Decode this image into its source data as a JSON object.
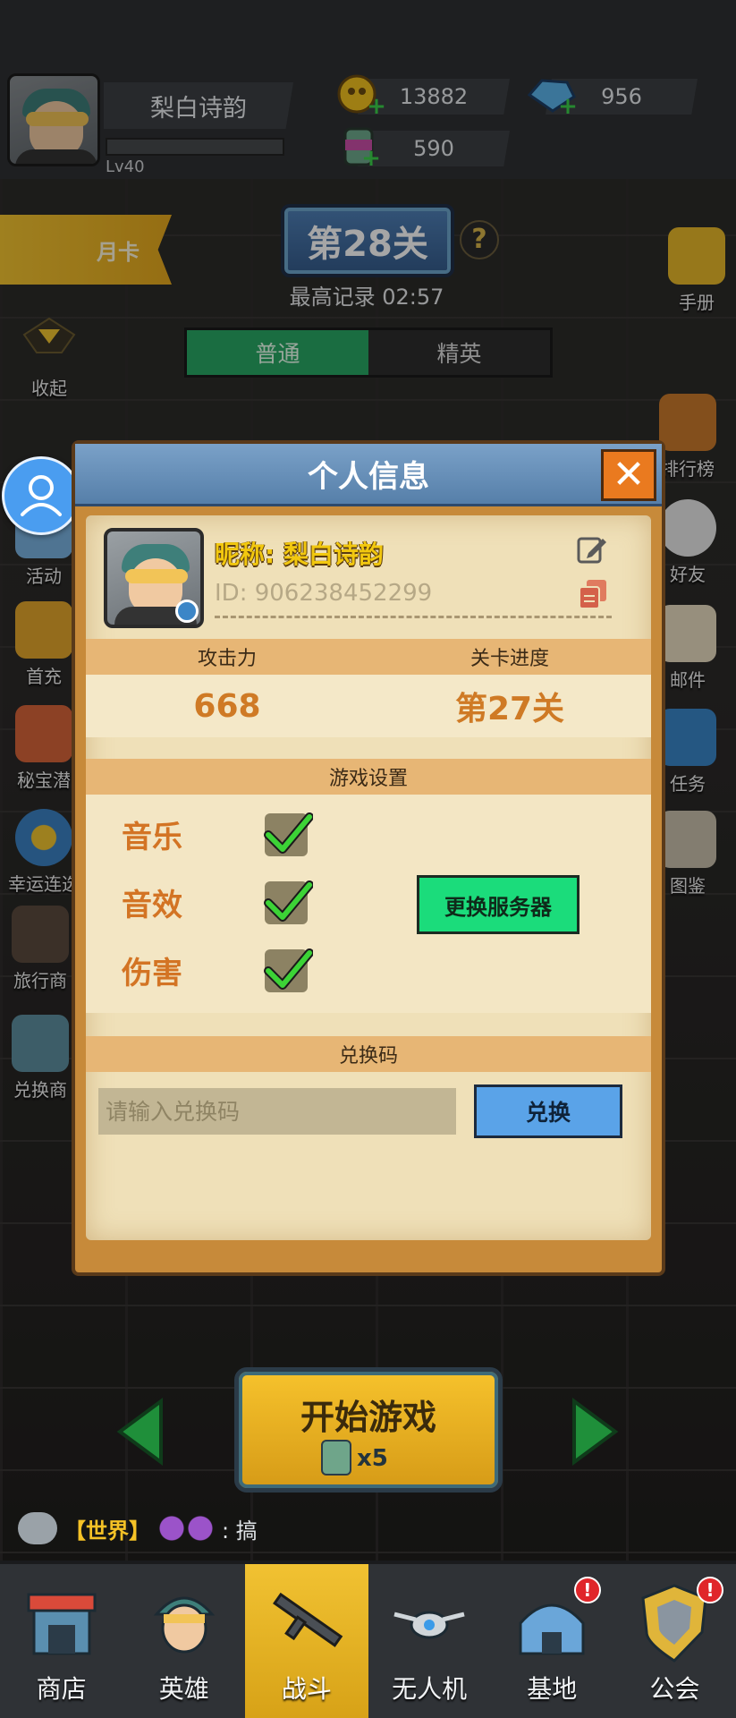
{
  "player": {
    "name": "梨白诗韵",
    "level": "Lv40"
  },
  "resources": {
    "gold": "13882",
    "gems": "956",
    "energy": "590"
  },
  "stage": {
    "month_card": "月卡",
    "current_stage": "第28关",
    "best_record": "最高记录 02:57",
    "modes": [
      "普通",
      "精英"
    ],
    "active_mode": "普通"
  },
  "left_menu": [
    {
      "label": "收起",
      "icon": "collapse-arrow-icon"
    },
    {
      "label": "活动",
      "icon": "gift-icon"
    },
    {
      "label": "首充",
      "icon": "treasure-chest-icon"
    },
    {
      "label": "秘宝潜",
      "icon": "mystery-box-icon"
    },
    {
      "label": "幸运连选",
      "icon": "lucky-wheel-icon"
    },
    {
      "label": "旅行商",
      "icon": "merchant-icon"
    },
    {
      "label": "兑换商",
      "icon": "vending-machine-icon"
    }
  ],
  "right_menu": [
    {
      "label": "手册",
      "icon": "handbook-icon"
    },
    {
      "label": "排行榜",
      "icon": "leaderboard-icon"
    },
    {
      "label": "好友",
      "icon": "friends-icon"
    },
    {
      "label": "邮件",
      "icon": "mail-icon"
    },
    {
      "label": "任务",
      "icon": "calendar-icon"
    },
    {
      "label": "图鉴",
      "icon": "album-icon"
    }
  ],
  "modal": {
    "title": "个人信息",
    "nickname": "昵称: 梨白诗韵",
    "player_id": "ID: 906238452299",
    "attack_label": "攻击力",
    "attack_value": "668",
    "progress_label": "关卡进度",
    "progress_value": "第27关",
    "settings_title": "游戏设置",
    "settings": [
      {
        "label": "音乐",
        "checked": true
      },
      {
        "label": "音效",
        "checked": true
      },
      {
        "label": "伤害",
        "checked": true
      }
    ],
    "server_button": "更换服务器",
    "redeem_title": "兑换码",
    "redeem_placeholder": "请输入兑换码",
    "redeem_button": "兑换"
  },
  "start": {
    "label": "开始游戏",
    "cost": "x5"
  },
  "chat": {
    "channel": "【世界】",
    "message": ": 搞"
  },
  "bottom_nav": [
    {
      "label": "商店",
      "icon": "shop-icon",
      "alert": false
    },
    {
      "label": "英雄",
      "icon": "hero-icon",
      "alert": false
    },
    {
      "label": "战斗",
      "icon": "rifle-icon",
      "alert": false,
      "active": true
    },
    {
      "label": "无人机",
      "icon": "drone-icon",
      "alert": false
    },
    {
      "label": "基地",
      "icon": "base-icon",
      "alert": true
    },
    {
      "label": "公会",
      "icon": "guild-shield-icon",
      "alert": true
    }
  ],
  "colors": {
    "accent_gold": "#f4c531",
    "active_tab_green": "#28a865",
    "server_btn_green": "#1bdc7b",
    "redeem_btn_blue": "#5aa3e8",
    "close_orange": "#ea7a1f",
    "stat_orange": "#cf7a25"
  }
}
